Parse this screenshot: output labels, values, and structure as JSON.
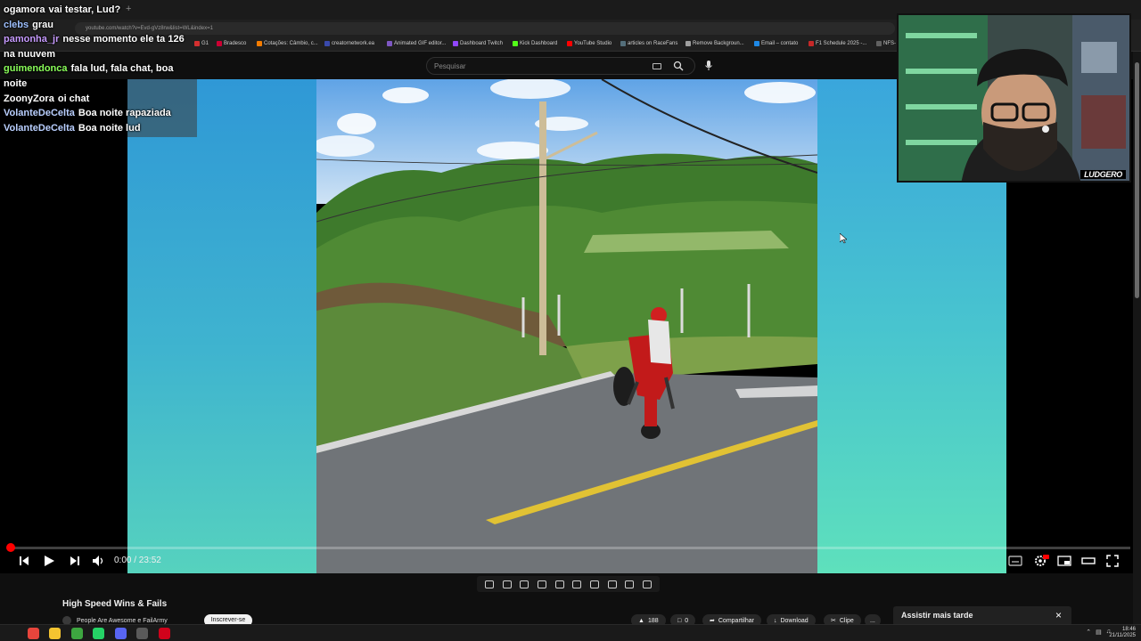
{
  "browser": {
    "url": "youtube.com/watch?v=Evd-gVz8rw&list=WL&index=1",
    "new_tab_symbol": "+",
    "bookmarks": [
      {
        "label": "G1",
        "color": "#d32f2f"
      },
      {
        "label": "Bradesco",
        "color": "#cc0033"
      },
      {
        "label": "Cotações: Câmbio, c...",
        "color": "#f57c00"
      },
      {
        "label": "creatornetwork.ea",
        "color": "#3949ab"
      },
      {
        "label": "Animated GIF editor...",
        "color": "#7e57c2"
      },
      {
        "label": "Dashboard Twitch",
        "color": "#9146ff"
      },
      {
        "label": "Kick Dashboard",
        "color": "#53fc18"
      },
      {
        "label": "YouTube Studio",
        "color": "#ff0000"
      },
      {
        "label": "articles on RaceFans",
        "color": "#546e7a"
      },
      {
        "label": "Remove Backgroun...",
        "color": "#9e9e9e"
      },
      {
        "label": "Email – contato",
        "color": "#1e88e5"
      },
      {
        "label": "F1 Schedule 2025 -...",
        "color": "#c62828"
      },
      {
        "label": "NFS-",
        "color": "#616161"
      }
    ]
  },
  "search": {
    "placeholder": "Pesquisar"
  },
  "player": {
    "time": "0:00 / 23:52",
    "progress": 0,
    "accent": "#ff0000"
  },
  "video": {
    "title": "High Speed Wins & Fails",
    "channel": "People Are Awesome e FailArmy",
    "subscribe": "Inscrever-se",
    "likes": "188",
    "comments": "0",
    "share": "Compartilhar",
    "download": "Download",
    "clip": "Clipe",
    "more": "..."
  },
  "toast": {
    "text": "Assistir mais tarde",
    "close": "×"
  },
  "chat": [
    {
      "user": "ogamora",
      "color": "#ffffff",
      "text": "vai testar, Lud?"
    },
    {
      "user": "clebs",
      "color": "#9ec0ff",
      "text": "grau"
    },
    {
      "user": "pamonha_jr",
      "color": "#c79bff",
      "text": "nesse momento ele ta 126 na nuuvem"
    },
    {
      "user": "guimendonca",
      "color": "#8aff5a",
      "text": "fala lud, fala chat, boa noite"
    },
    {
      "user": "ZoonyZora",
      "color": "#ffffff",
      "text": "oi chat"
    },
    {
      "user": "VolanteDeCelta",
      "color": "#b9cfff",
      "text": "Boa noite rapaziada"
    },
    {
      "user": "VolanteDeCelta",
      "color": "#b9cfff",
      "text": "Boa noite lud"
    }
  ],
  "webcam": {
    "tag": "LUDGERO"
  },
  "taskbar": {
    "clock_time": "18:46",
    "clock_date": "21/11/2025",
    "apps": [
      {
        "name": "chrome",
        "color": "#e8453c"
      },
      {
        "name": "files",
        "color": "#f4c430"
      },
      {
        "name": "xbox",
        "color": "#3da640"
      },
      {
        "name": "whatsapp",
        "color": "#25d366"
      },
      {
        "name": "discord",
        "color": "#5865f2"
      },
      {
        "name": "obs",
        "color": "#5a5a5a"
      },
      {
        "name": "app",
        "color": "#d0021b"
      }
    ]
  }
}
